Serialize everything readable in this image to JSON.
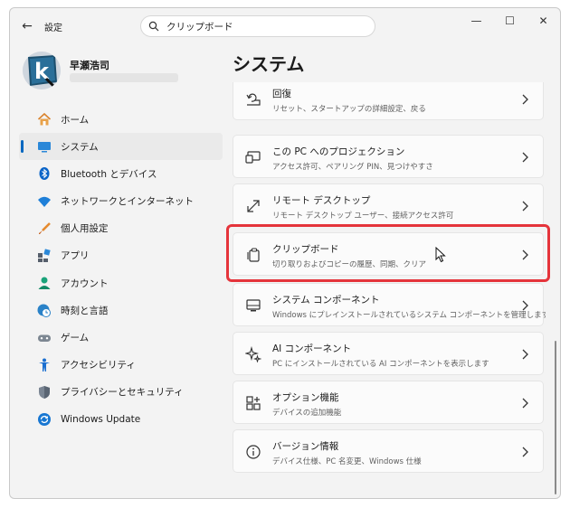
{
  "titlebar": {
    "back_label": "←",
    "app_title": "設定",
    "search_value": "クリップボード",
    "minimize": "—",
    "maximize": "☐",
    "close": "✕"
  },
  "profile": {
    "name": "早瀬浩司"
  },
  "sidebar": {
    "items": [
      {
        "label": "ホーム",
        "icon": "home-icon"
      },
      {
        "label": "システム",
        "icon": "system-icon",
        "selected": true
      },
      {
        "label": "Bluetooth とデバイス",
        "icon": "bluetooth-icon"
      },
      {
        "label": "ネットワークとインターネット",
        "icon": "wifi-icon"
      },
      {
        "label": "個人用設定",
        "icon": "brush-icon"
      },
      {
        "label": "アプリ",
        "icon": "apps-icon"
      },
      {
        "label": "アカウント",
        "icon": "account-icon"
      },
      {
        "label": "時刻と言語",
        "icon": "clock-globe-icon"
      },
      {
        "label": "ゲーム",
        "icon": "gamepad-icon"
      },
      {
        "label": "アクセシビリティ",
        "icon": "accessibility-icon"
      },
      {
        "label": "プライバシーとセキュリティ",
        "icon": "shield-icon"
      },
      {
        "label": "Windows Update",
        "icon": "update-icon"
      }
    ]
  },
  "main": {
    "title": "システム",
    "cards": [
      {
        "title": "回復",
        "subtitle": "リセット、スタートアップの詳細設定、戻る",
        "icon": "recovery-icon"
      },
      {
        "title": "この PC へのプロジェクション",
        "subtitle": "アクセス許可、ペアリング PIN、見つけやすさ",
        "icon": "projection-icon"
      },
      {
        "title": "リモート デスクトップ",
        "subtitle": "リモート デスクトップ ユーザー、接続アクセス許可",
        "icon": "remote-desktop-icon"
      },
      {
        "title": "クリップボード",
        "subtitle": "切り取りおよびコピーの履歴、同期、クリア",
        "icon": "clipboard-icon",
        "highlighted": true
      },
      {
        "title": "システム コンポーネント",
        "subtitle": "Windows にプレインストールされているシステム コンポーネントを管理します",
        "icon": "system-components-icon"
      },
      {
        "title": "AI コンポーネント",
        "subtitle": "PC にインストールされている AI コンポーネントを表示します",
        "icon": "ai-sparkle-icon"
      },
      {
        "title": "オプション機能",
        "subtitle": "デバイスの追加機能",
        "icon": "optional-features-icon"
      },
      {
        "title": "バージョン情報",
        "subtitle": "デバイス仕様、PC 名変更、Windows 仕様",
        "icon": "info-icon"
      }
    ]
  },
  "colors": {
    "accent": "#0067c0",
    "highlight": "#e5343b"
  }
}
